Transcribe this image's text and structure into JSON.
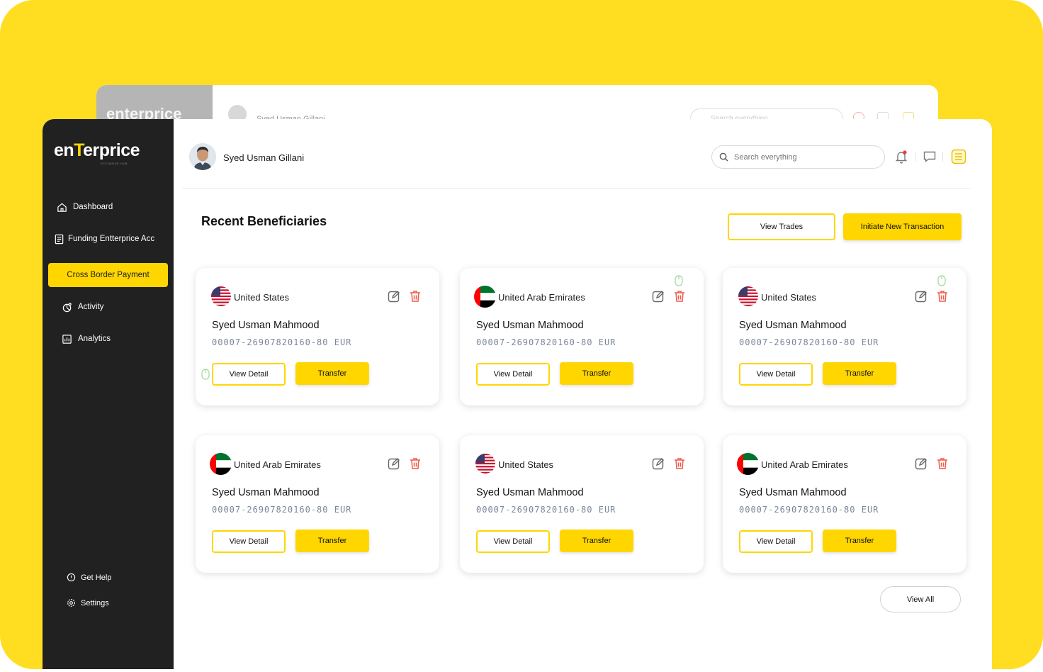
{
  "background_window": {
    "logo": "enterprice",
    "user_name": "Syed Usman Gillani",
    "search_placeholder": "Search everything"
  },
  "brand": {
    "logo_text_pre": "en",
    "logo_text_accent": "T",
    "logo_text_post": "erprice",
    "tagline": "EXCHANGE HUB",
    "accent_color": "#FFD600",
    "sidebar_color": "#212121"
  },
  "sidebar": {
    "items": [
      {
        "label": "Dashboard",
        "icon": "home-icon"
      },
      {
        "label": "Funding Entterprice Acc",
        "icon": "document-icon"
      },
      {
        "label": "Cross Border Payment",
        "icon": "none",
        "active": true
      },
      {
        "label": "Activity",
        "icon": "activity-icon"
      },
      {
        "label": "Analytics",
        "icon": "analytics-icon"
      }
    ],
    "footer": [
      {
        "label": "Get Help",
        "icon": "help-icon"
      },
      {
        "label": "Settings",
        "icon": "gear-icon"
      }
    ]
  },
  "header": {
    "user_name": "Syed Usman Gillani",
    "search_placeholder": "Search everything",
    "icons": [
      "bell-icon",
      "chat-icon",
      "menu-icon"
    ]
  },
  "main": {
    "title": "Recent Beneficiaries",
    "view_trades": "View Trades",
    "initiate": "Initiate New Transaction",
    "view_all": "View All"
  },
  "beneficiaries": [
    {
      "country": "United States",
      "flag": "us",
      "name": "Syed Usman Mahmood",
      "account": "00007-26907820160-80 EUR",
      "view": "View Detail",
      "transfer": "Transfer"
    },
    {
      "country": "United Arab Emirates",
      "flag": "uae",
      "name": "Syed Usman Mahmood",
      "account": "00007-26907820160-80 EUR",
      "view": "View Detail",
      "transfer": "Transfer"
    },
    {
      "country": "United States",
      "flag": "us",
      "name": "Syed Usman Mahmood",
      "account": "00007-26907820160-80 EUR",
      "view": "View Detail",
      "transfer": "Transfer"
    },
    {
      "country": "United Arab Emirates",
      "flag": "uae",
      "name": "Syed Usman Mahmood",
      "account": "00007-26907820160-80 EUR",
      "view": "View Detail",
      "transfer": "Transfer"
    },
    {
      "country": "United States",
      "flag": "us",
      "name": "Syed Usman Mahmood",
      "account": "00007-26907820160-80 EUR",
      "view": "View Detail",
      "transfer": "Transfer"
    },
    {
      "country": "United Arab Emirates",
      "flag": "uae",
      "name": "Syed Usman Mahmood",
      "account": "00007-26907820160-80 EUR",
      "view": "View Detail",
      "transfer": "Transfer"
    }
  ]
}
